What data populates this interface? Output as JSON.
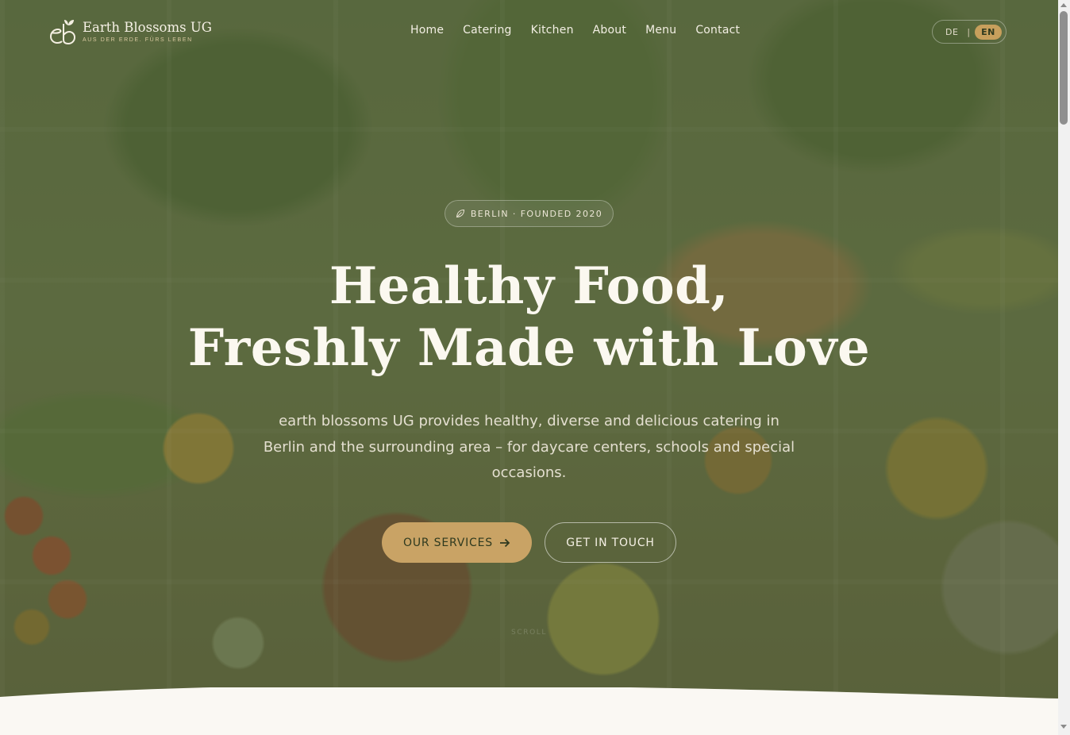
{
  "brand": {
    "name": "Earth Blossoms UG",
    "tagline": "AUS DER ERDE. FÜRS LEBEN",
    "logo_icon": "sprout-eb-monogram-icon"
  },
  "nav": {
    "items": [
      {
        "label": "Home"
      },
      {
        "label": "Catering"
      },
      {
        "label": "Kitchen"
      },
      {
        "label": "About"
      },
      {
        "label": "Menu"
      },
      {
        "label": "Contact"
      }
    ]
  },
  "language": {
    "options": [
      "DE",
      "EN"
    ],
    "separator": "|",
    "selected": "EN"
  },
  "hero": {
    "badge": {
      "icon": "leaf-icon",
      "text": "BERLIN · FOUNDED 2020"
    },
    "headline_line1": "Healthy Food,",
    "headline_line2": "Freshly Made with Love",
    "subtitle": "earth blossoms UG provides healthy, diverse and delicious catering in Berlin and the surrounding area – for daycare centers, schools and special occasions.",
    "primary_button": {
      "label": "OUR SERVICES",
      "icon": "arrow-right-icon"
    },
    "secondary_button": {
      "label": "GET IN TOUCH"
    },
    "scroll_hint": "SCROLL"
  },
  "colors": {
    "accent": "#c9a365",
    "overlay": "#5c6840",
    "text_light": "#fbf8f0",
    "page_background": "#faf8f3"
  }
}
